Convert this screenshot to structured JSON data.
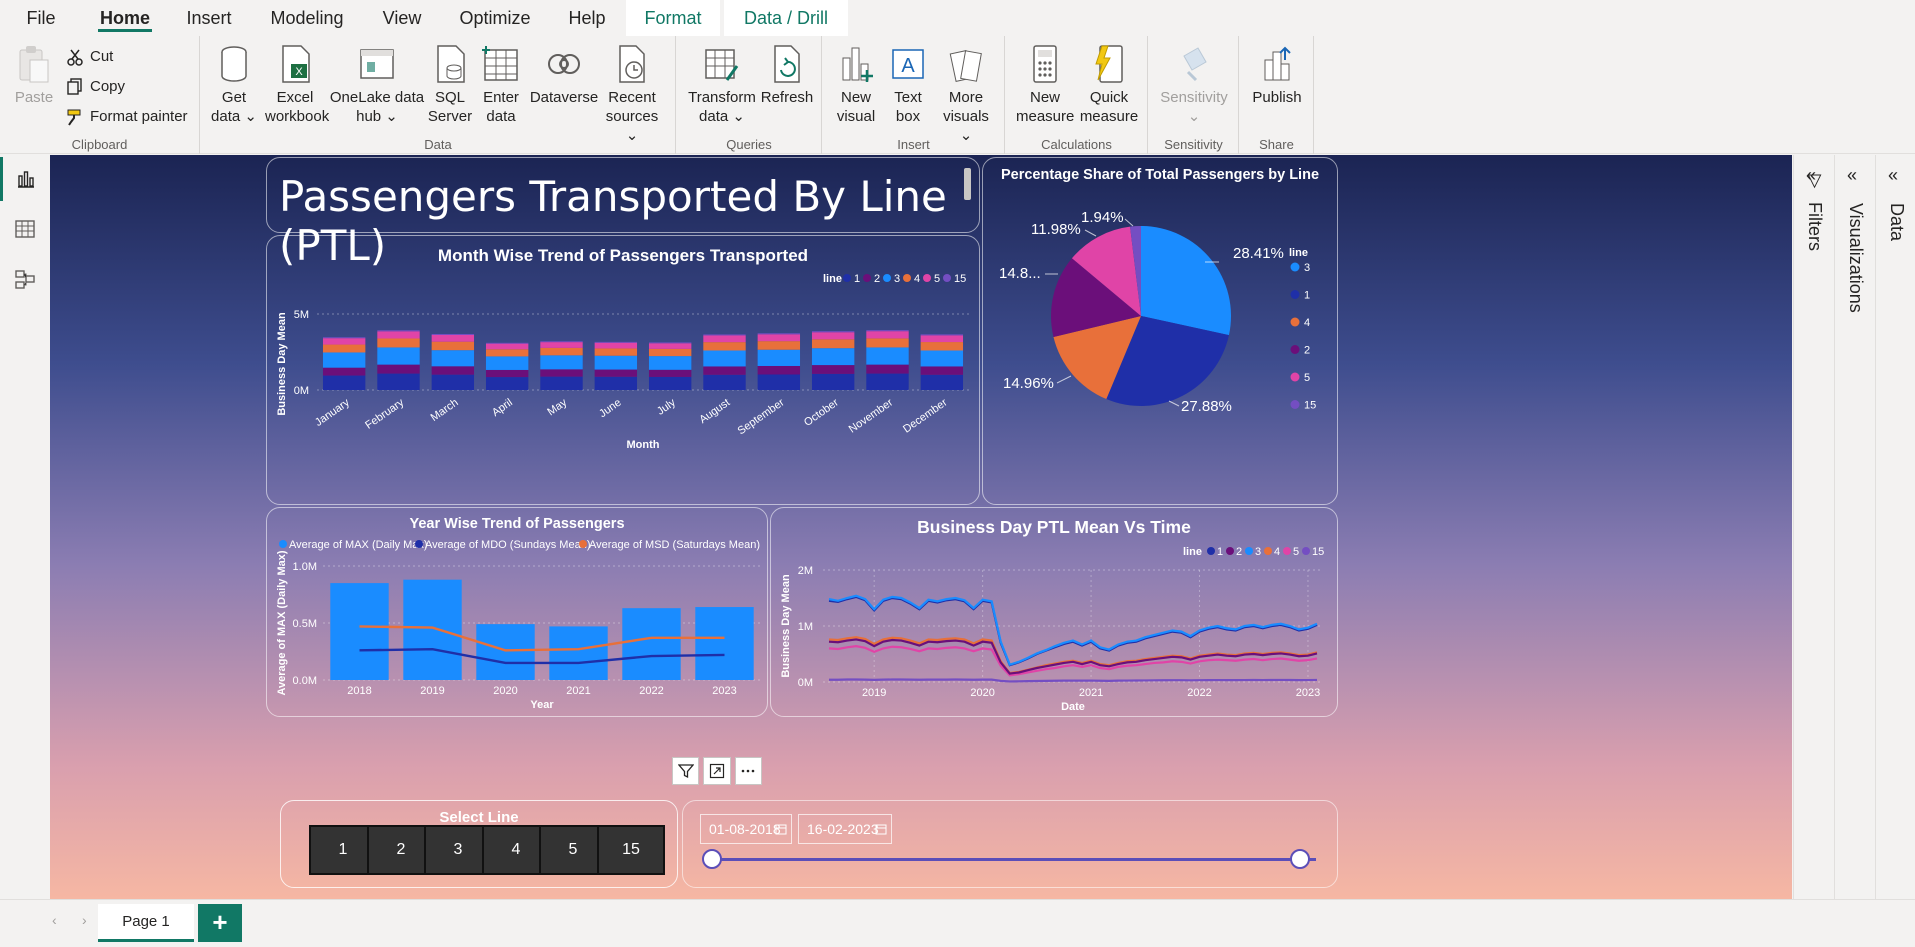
{
  "menu": {
    "tabs": [
      "File",
      "Home",
      "Insert",
      "Modeling",
      "View",
      "Optimize",
      "Help",
      "Format",
      "Data / Drill"
    ],
    "active": "Home"
  },
  "ribbon": {
    "clipboard": {
      "paste": "Paste",
      "cut": "Cut",
      "copy": "Copy",
      "format_painter": "Format painter",
      "label": "Clipboard"
    },
    "data": {
      "get_data": [
        "Get",
        "data ⌄"
      ],
      "excel": [
        "Excel",
        "workbook"
      ],
      "onelake": [
        "OneLake data",
        "hub ⌄"
      ],
      "sql": [
        "SQL",
        "Server"
      ],
      "enter": [
        "Enter",
        "data"
      ],
      "dataverse": [
        "Dataverse",
        ""
      ],
      "recent": [
        "Recent",
        "sources ⌄"
      ],
      "label": "Data"
    },
    "queries": {
      "transform": [
        "Transform",
        "data ⌄"
      ],
      "refresh": [
        "Refresh",
        ""
      ],
      "label": "Queries"
    },
    "insert": {
      "new_visual": [
        "New",
        "visual"
      ],
      "text_box": [
        "Text",
        "box"
      ],
      "more_visuals": [
        "More",
        "visuals ⌄"
      ],
      "label": "Insert"
    },
    "calculations": {
      "new_measure": [
        "New",
        "measure"
      ],
      "quick_measure": [
        "Quick",
        "measure"
      ],
      "label": "Calculations"
    },
    "sensitivity": {
      "btn": [
        "Sensitivity",
        "⌄"
      ],
      "label": "Sensitivity"
    },
    "share": {
      "publish": [
        "Publish",
        ""
      ],
      "label": "Share"
    }
  },
  "report": {
    "title": "Passengers Transported By Line (PTL)",
    "month_chart": {
      "title": "Month Wise Trend of Passengers Transported",
      "legend_title": "line",
      "xlabel": "Month",
      "ylabel": "Business Day Mean",
      "yticks": [
        "5M",
        "0M"
      ]
    },
    "pie_chart": {
      "title": "Percentage Share of Total Passengers by Line",
      "legend_title": "line"
    },
    "year_chart": {
      "title": "Year Wise Trend of Passengers",
      "xlabel": "Year",
      "ylabel": "Average of MAX (Daily Max)",
      "yticks": [
        "1.0M",
        "0.5M",
        "0.0M"
      ]
    },
    "time_chart": {
      "title": "Business Day PTL Mean Vs Time",
      "legend_title": "line",
      "xlabel": "Date",
      "ylabel": "Business Day Mean",
      "yticks": [
        "2M",
        "1M",
        "0M"
      ]
    },
    "slicer": {
      "title": "Select Line",
      "options": [
        "1",
        "2",
        "3",
        "4",
        "5",
        "15"
      ]
    },
    "date_range": {
      "start": "01-08-2018",
      "end": "16-02-2023"
    }
  },
  "panes": {
    "filters": "Filters",
    "visualizations": "Visualizations",
    "data": "Data"
  },
  "pages": {
    "current": "Page 1",
    "add": "+"
  },
  "colors": {
    "line_1": "#1f2fa8",
    "line_2": "#6b0f7a",
    "line_3": "#1a8cff",
    "line_4": "#e8703a",
    "line_5": "#e044a7",
    "line_15": "#744ec2",
    "accent": "#117865"
  },
  "chart_data": [
    {
      "type": "bar",
      "title": "Month Wise Trend of Passengers Transported",
      "stacked": true,
      "xlabel": "Month",
      "ylabel": "Business Day Mean",
      "ylim": [
        0,
        5000000
      ],
      "categories": [
        "January",
        "February",
        "March",
        "April",
        "May",
        "June",
        "July",
        "August",
        "September",
        "October",
        "November",
        "December"
      ],
      "series": [
        {
          "name": "1",
          "color": "#1f2fa8",
          "values": [
            950000,
            1080000,
            1010000,
            850000,
            880000,
            870000,
            860000,
            1000000,
            1020000,
            1060000,
            1080000,
            1000000
          ]
        },
        {
          "name": "2",
          "color": "#6b0f7a",
          "values": [
            520000,
            590000,
            550000,
            470000,
            480000,
            475000,
            470000,
            550000,
            560000,
            580000,
            590000,
            550000
          ]
        },
        {
          "name": "3",
          "color": "#1a8cff",
          "values": [
            1000000,
            1130000,
            1060000,
            890000,
            920000,
            910000,
            900000,
            1050000,
            1070000,
            1110000,
            1130000,
            1050000
          ]
        },
        {
          "name": "4",
          "color": "#e8703a",
          "values": [
            520000,
            590000,
            560000,
            470000,
            490000,
            480000,
            475000,
            550000,
            565000,
            585000,
            595000,
            555000
          ]
        },
        {
          "name": "5",
          "color": "#e044a7",
          "values": [
            420000,
            470000,
            440000,
            370000,
            380000,
            375000,
            370000,
            440000,
            450000,
            465000,
            475000,
            440000
          ]
        },
        {
          "name": "15",
          "color": "#744ec2",
          "values": [
            60000,
            70000,
            65000,
            55000,
            56000,
            55000,
            55000,
            65000,
            67000,
            69000,
            70000,
            65000
          ]
        }
      ]
    },
    {
      "type": "pie",
      "title": "Percentage Share of Total Passengers by Line",
      "slices": [
        {
          "label": "3",
          "value": 28.41,
          "display": "28.41%",
          "color": "#1a8cff"
        },
        {
          "label": "1",
          "value": 27.88,
          "display": "27.88%",
          "color": "#1f2fa8"
        },
        {
          "label": "4",
          "value": 14.96,
          "display": "14.96%",
          "color": "#e8703a"
        },
        {
          "label": "2",
          "value": 14.83,
          "display": "14.8...",
          "color": "#6b0f7a"
        },
        {
          "label": "5",
          "value": 11.98,
          "display": "11.98%",
          "color": "#e044a7"
        },
        {
          "label": "15",
          "value": 1.94,
          "display": "1.94%",
          "color": "#744ec2"
        }
      ],
      "legend_order": [
        "3",
        "1",
        "4",
        "2",
        "5",
        "15"
      ]
    },
    {
      "type": "bar",
      "title": "Year Wise Trend of Passengers",
      "xlabel": "Year",
      "ylabel": "Average of MAX (Daily Max)",
      "ylim": [
        0,
        1000000
      ],
      "categories": [
        "2018",
        "2019",
        "2020",
        "2021",
        "2022",
        "2023"
      ],
      "series": [
        {
          "name": "Average of MAX (Daily Max)",
          "type": "bar",
          "color": "#1a8cff",
          "values": [
            850000,
            880000,
            490000,
            470000,
            630000,
            640000
          ]
        },
        {
          "name": "Average of MDO (Sundays Mean)",
          "type": "line",
          "color": "#1f2fa8",
          "values": [
            260000,
            270000,
            150000,
            150000,
            210000,
            220000
          ]
        },
        {
          "name": "Average of MSD (Saturdays Mean)",
          "type": "line",
          "color": "#e8703a",
          "values": [
            470000,
            460000,
            260000,
            270000,
            370000,
            370000
          ]
        }
      ]
    },
    {
      "type": "line",
      "title": "Business Day PTL Mean Vs Time",
      "xlabel": "Date",
      "ylabel": "Business Day Mean",
      "ylim": [
        0,
        2000000
      ],
      "xticks": [
        "2019",
        "2020",
        "2021",
        "2022",
        "2023"
      ],
      "x": [
        "2018-08",
        "2018-09",
        "2018-10",
        "2018-11",
        "2018-12",
        "2019-01",
        "2019-02",
        "2019-03",
        "2019-04",
        "2019-05",
        "2019-06",
        "2019-07",
        "2019-08",
        "2019-09",
        "2019-10",
        "2019-11",
        "2019-12",
        "2020-01",
        "2020-02",
        "2020-03",
        "2020-04",
        "2020-05",
        "2020-06",
        "2020-07",
        "2020-08",
        "2020-09",
        "2020-10",
        "2020-11",
        "2020-12",
        "2021-01",
        "2021-02",
        "2021-03",
        "2021-04",
        "2021-05",
        "2021-06",
        "2021-07",
        "2021-08",
        "2021-09",
        "2021-10",
        "2021-11",
        "2021-12",
        "2022-01",
        "2022-02",
        "2022-03",
        "2022-04",
        "2022-05",
        "2022-06",
        "2022-07",
        "2022-08",
        "2022-09",
        "2022-10",
        "2022-11",
        "2022-12",
        "2023-01",
        "2023-02"
      ],
      "series": [
        {
          "name": "1",
          "color": "#1f2fa8",
          "values": [
            1450000,
            1430000,
            1480000,
            1520000,
            1460000,
            1280000,
            1450000,
            1500000,
            1480000,
            1400000,
            1300000,
            1450000,
            1420000,
            1460000,
            1480000,
            1440000,
            1300000,
            1450000,
            1420000,
            700000,
            300000,
            350000,
            420000,
            500000,
            560000,
            620000,
            680000,
            720000,
            650000,
            720000,
            600000,
            560000,
            650000,
            700000,
            720000,
            780000,
            820000,
            860000,
            900000,
            880000,
            800000,
            900000,
            950000,
            980000,
            940000,
            920000,
            980000,
            1000000,
            960000,
            1000000,
            1020000,
            980000,
            920000,
            950000,
            1020000
          ]
        },
        {
          "name": "2",
          "color": "#6b0f7a",
          "values": [
            720000,
            710000,
            740000,
            760000,
            730000,
            640000,
            720000,
            750000,
            740000,
            700000,
            650000,
            720000,
            710000,
            730000,
            740000,
            720000,
            650000,
            720000,
            700000,
            350000,
            150000,
            170000,
            210000,
            250000,
            280000,
            310000,
            340000,
            360000,
            320000,
            360000,
            300000,
            280000,
            320000,
            350000,
            360000,
            390000,
            410000,
            430000,
            450000,
            440000,
            400000,
            450000,
            470000,
            490000,
            470000,
            460000,
            490000,
            500000,
            480000,
            500000,
            510000,
            490000,
            460000,
            470000,
            510000
          ]
        },
        {
          "name": "3",
          "color": "#1a8cff",
          "values": [
            1480000,
            1450000,
            1500000,
            1540000,
            1480000,
            1300000,
            1470000,
            1520000,
            1500000,
            1420000,
            1320000,
            1470000,
            1440000,
            1480000,
            1500000,
            1460000,
            1320000,
            1470000,
            1440000,
            720000,
            310000,
            360000,
            430000,
            510000,
            570000,
            640000,
            700000,
            740000,
            670000,
            740000,
            620000,
            580000,
            670000,
            720000,
            740000,
            800000,
            840000,
            880000,
            920000,
            900000,
            820000,
            920000,
            970000,
            1000000,
            960000,
            940000,
            1000000,
            1020000,
            980000,
            1020000,
            1040000,
            1000000,
            940000,
            970000,
            1040000
          ]
        },
        {
          "name": "4",
          "color": "#e8703a",
          "values": [
            760000,
            750000,
            780000,
            800000,
            770000,
            680000,
            760000,
            790000,
            780000,
            740000,
            690000,
            760000,
            750000,
            770000,
            780000,
            760000,
            690000,
            760000,
            740000,
            370000,
            160000,
            180000,
            220000,
            260000,
            300000,
            330000,
            360000,
            380000,
            340000,
            380000,
            320000,
            300000,
            340000,
            370000,
            380000,
            410000,
            430000,
            450000,
            470000,
            460000,
            420000,
            470000,
            490000,
            510000,
            490000,
            480000,
            510000,
            520000,
            500000,
            520000,
            530000,
            510000,
            480000,
            490000,
            530000
          ]
        },
        {
          "name": "5",
          "color": "#e044a7",
          "values": [
            600000,
            590000,
            620000,
            640000,
            610000,
            540000,
            600000,
            630000,
            620000,
            590000,
            550000,
            600000,
            590000,
            610000,
            620000,
            600000,
            550000,
            600000,
            580000,
            290000,
            120000,
            140000,
            170000,
            200000,
            230000,
            250000,
            280000,
            300000,
            270000,
            300000,
            250000,
            230000,
            270000,
            290000,
            300000,
            320000,
            340000,
            350000,
            370000,
            360000,
            330000,
            370000,
            390000,
            400000,
            390000,
            380000,
            400000,
            410000,
            390000,
            410000,
            420000,
            400000,
            380000,
            390000,
            420000
          ]
        },
        {
          "name": "15",
          "color": "#744ec2",
          "values": [
            40000,
            40000,
            45000,
            45000,
            42000,
            38000,
            42000,
            45000,
            44000,
            42000,
            40000,
            42000,
            42000,
            43000,
            44000,
            43000,
            40000,
            43000,
            42000,
            20000,
            10000,
            12000,
            15000,
            18000,
            20000,
            22000,
            24000,
            26000,
            24000,
            26000,
            22000,
            20000,
            24000,
            26000,
            27000,
            28000,
            30000,
            31000,
            32000,
            32000,
            30000,
            32000,
            34000,
            35000,
            34000,
            33000,
            35000,
            36000,
            35000,
            36000,
            37000,
            36000,
            34000,
            35000,
            37000
          ]
        }
      ]
    }
  ]
}
